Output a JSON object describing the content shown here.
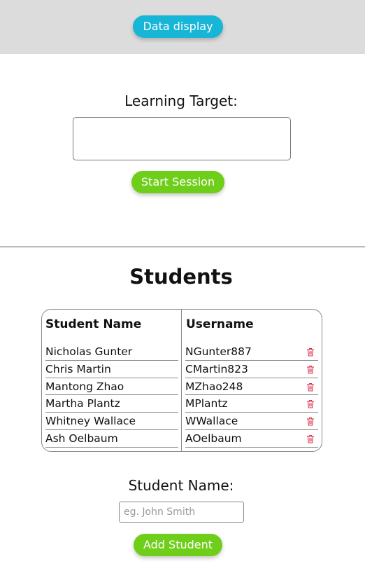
{
  "header": {
    "data_display_label": "Data display"
  },
  "session": {
    "learning_target_label": "Learning Target:",
    "learning_target_value": "",
    "start_label": "Start Session"
  },
  "students": {
    "title": "Students",
    "columns": {
      "name": "Student Name",
      "username": "Username"
    },
    "rows": [
      {
        "name": "Nicholas Gunter",
        "username": "NGunter887"
      },
      {
        "name": "Chris Martin",
        "username": "CMartin823"
      },
      {
        "name": "Mantong Zhao",
        "username": "MZhao248"
      },
      {
        "name": "Martha Plantz",
        "username": "MPlantz"
      },
      {
        "name": "Whitney Wallace",
        "username": "WWallace"
      },
      {
        "name": "Ash Oelbaum",
        "username": "AOelbaum"
      }
    ],
    "delete_icon": "trash-icon"
  },
  "add_student": {
    "label": "Student Name:",
    "placeholder": "eg. John Smith",
    "button_label": "Add Student"
  },
  "colors": {
    "topbar_bg": "#dcdcdc",
    "data_button": "#17b5d6",
    "green_button": "#6fce19",
    "trash": "#d9324a"
  }
}
